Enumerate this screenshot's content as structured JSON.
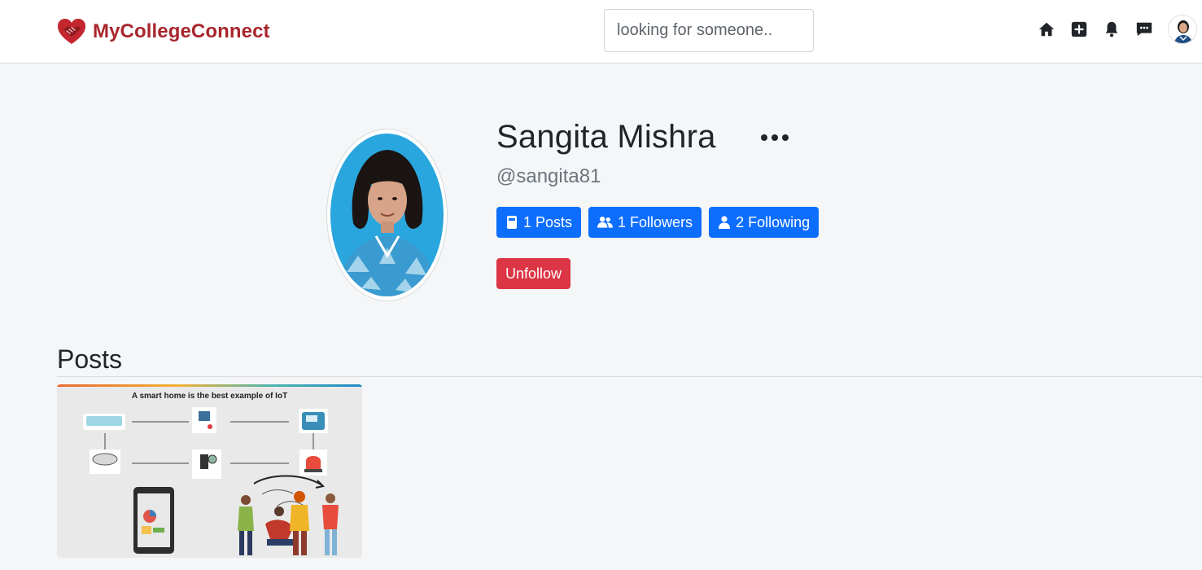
{
  "brand": {
    "name": "MyCollegeConnect",
    "color": "#a8262c"
  },
  "search": {
    "placeholder": "looking for someone.."
  },
  "nav": {
    "icons": [
      "home-icon",
      "add-post-icon",
      "bell-icon",
      "messages-icon",
      "avatar"
    ]
  },
  "profile": {
    "name": "Sangita Mishra",
    "username": "@sangita81",
    "stats": {
      "posts_label": "1 Posts",
      "followers_label": "1 Followers",
      "following_label": "2 Following"
    },
    "unfollow_label": "Unfollow"
  },
  "posts": {
    "heading": "Posts",
    "items": [
      {
        "title": "A smart home is the best example of IoT"
      }
    ]
  },
  "colors": {
    "primary": "#0d6efd",
    "danger": "#dc3545",
    "background": "#f4f6f8"
  }
}
